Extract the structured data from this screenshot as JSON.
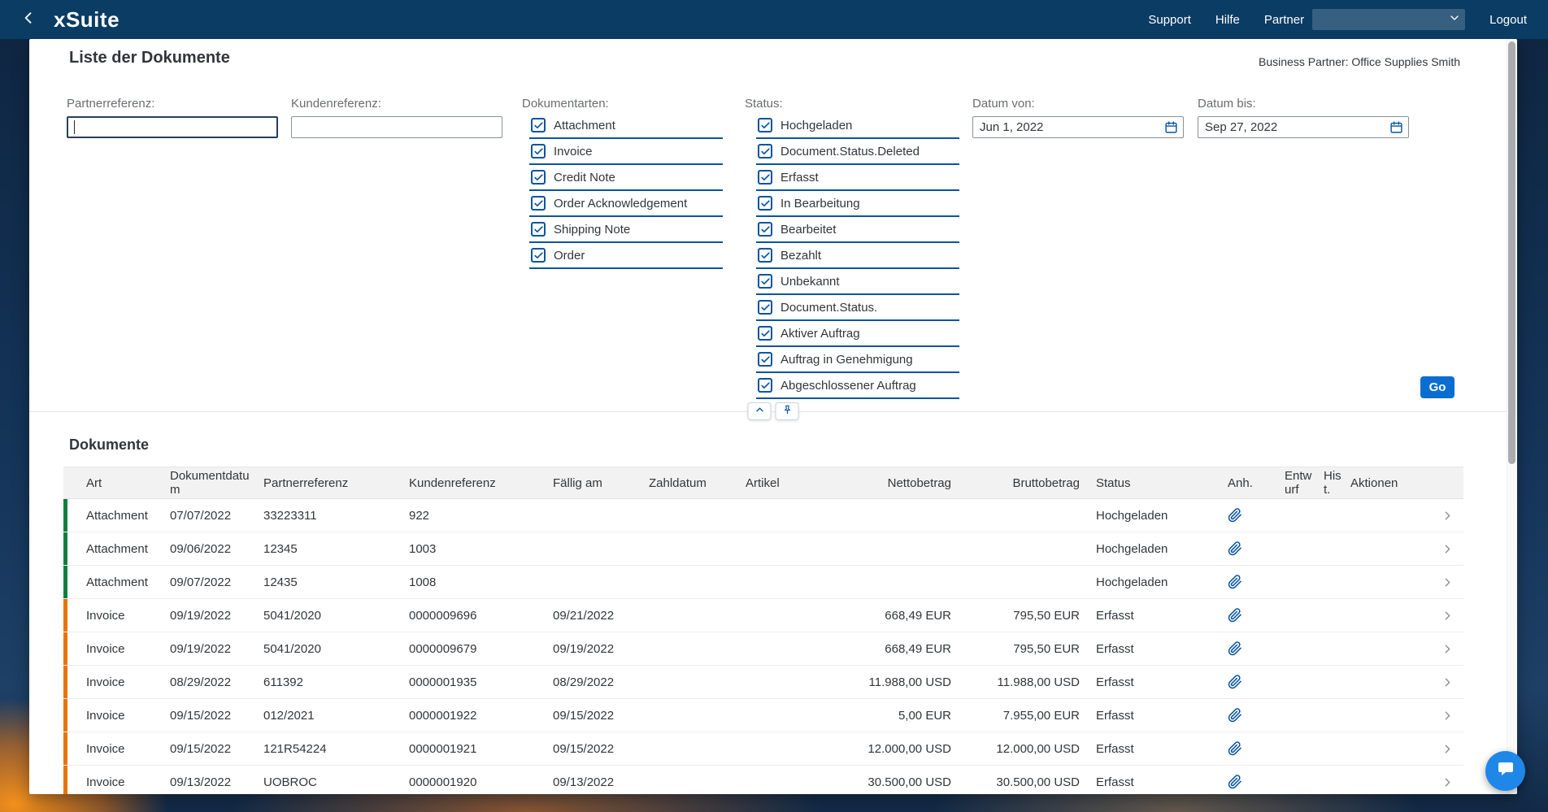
{
  "topbar": {
    "logo": "xSuite",
    "support_label": "Support",
    "help_label": "Hilfe",
    "partner_label": "Partner",
    "partner_value": "",
    "logout_label": "Logout"
  },
  "page": {
    "title": "Liste der Dokumente",
    "business_partner": "Business Partner: Office Supplies Smith"
  },
  "filters": {
    "partner_ref_label": "Partnerreferenz:",
    "partner_ref_value": "",
    "customer_ref_label": "Kundenreferenz:",
    "customer_ref_value": "",
    "doc_types_label": "Dokumentarten:",
    "doc_types": [
      "Attachment",
      "Invoice",
      "Credit Note",
      "Order Acknowledgement",
      "Shipping Note",
      "Order"
    ],
    "status_label": "Status:",
    "statuses": [
      "Hochgeladen",
      "Document.Status.Deleted",
      "Erfasst",
      "In Bearbeitung",
      "Bearbeitet",
      "Bezahlt",
      "Unbekannt",
      "Document.Status.",
      "Aktiver Auftrag",
      "Auftrag in Genehmigung",
      "Abgeschlossener Auftrag"
    ],
    "date_from_label": "Datum von:",
    "date_from_value": "Jun 1, 2022",
    "date_to_label": "Datum bis:",
    "date_to_value": "Sep 27, 2022",
    "go_label": "Go"
  },
  "table": {
    "title": "Dokumente",
    "headers": [
      "Art",
      "Dokumentdatum",
      "Partnerreferenz",
      "Kundenreferenz",
      "Fällig am",
      "Zahldatum",
      "Artikel",
      "Nettobetrag",
      "Bruttobetrag",
      "Status",
      "Anh.",
      "Entwurf",
      "Hist.",
      "Aktionen"
    ],
    "rows": [
      {
        "art": "Attachment",
        "date": "07/07/2022",
        "partner_ref": "33223311",
        "customer_ref": "922",
        "due_date": "",
        "pay_date": "",
        "article": "",
        "net": "",
        "gross": "",
        "status": "Hochgeladen"
      },
      {
        "art": "Attachment",
        "date": "09/06/2022",
        "partner_ref": "12345",
        "customer_ref": "1003",
        "due_date": "",
        "pay_date": "",
        "article": "",
        "net": "",
        "gross": "",
        "status": "Hochgeladen"
      },
      {
        "art": "Attachment",
        "date": "09/07/2022",
        "partner_ref": "12435",
        "customer_ref": "1008",
        "due_date": "",
        "pay_date": "",
        "article": "",
        "net": "",
        "gross": "",
        "status": "Hochgeladen"
      },
      {
        "art": "Invoice",
        "date": "09/19/2022",
        "partner_ref": "5041/2020",
        "customer_ref": "0000009696",
        "due_date": "09/21/2022",
        "pay_date": "",
        "article": "",
        "net": "668,49 EUR",
        "gross": "795,50 EUR",
        "status": "Erfasst"
      },
      {
        "art": "Invoice",
        "date": "09/19/2022",
        "partner_ref": "5041/2020",
        "customer_ref": "0000009679",
        "due_date": "09/19/2022",
        "pay_date": "",
        "article": "",
        "net": "668,49 EUR",
        "gross": "795,50 EUR",
        "status": "Erfasst"
      },
      {
        "art": "Invoice",
        "date": "08/29/2022",
        "partner_ref": "611392",
        "customer_ref": "0000001935",
        "due_date": "08/29/2022",
        "pay_date": "",
        "article": "",
        "net": "11.988,00 USD",
        "gross": "11.988,00 USD",
        "status": "Erfasst"
      },
      {
        "art": "Invoice",
        "date": "09/15/2022",
        "partner_ref": "012/2021",
        "customer_ref": "0000001922",
        "due_date": "09/15/2022",
        "pay_date": "",
        "article": "",
        "net": "5,00 EUR",
        "gross": "7.955,00 EUR",
        "status": "Erfasst"
      },
      {
        "art": "Invoice",
        "date": "09/15/2022",
        "partner_ref": "121R54224",
        "customer_ref": "0000001921",
        "due_date": "09/15/2022",
        "pay_date": "",
        "article": "",
        "net": "12.000,00 USD",
        "gross": "12.000,00 USD",
        "status": "Erfasst"
      },
      {
        "art": "Invoice",
        "date": "09/13/2022",
        "partner_ref": "UOBROC",
        "customer_ref": "0000001920",
        "due_date": "09/13/2022",
        "pay_date": "",
        "article": "",
        "net": "30.500,00 USD",
        "gross": "30.500,00 USD",
        "status": "Erfasst"
      }
    ]
  },
  "colors": {
    "topbar": "#0a3c64",
    "accent_blue": "#0854a0",
    "go_button": "#0a6ed1",
    "attachment_bar": "#107e3e",
    "invoice_bar": "#e9730c"
  },
  "icons": {
    "back": "chevron-left",
    "partner_dropdown": "chevron-down",
    "calendar": "calendar",
    "collapse": "chevron-up",
    "pin": "pin",
    "attachment": "paperclip",
    "row_nav": "chevron-right",
    "chat": "chat-bubble"
  }
}
